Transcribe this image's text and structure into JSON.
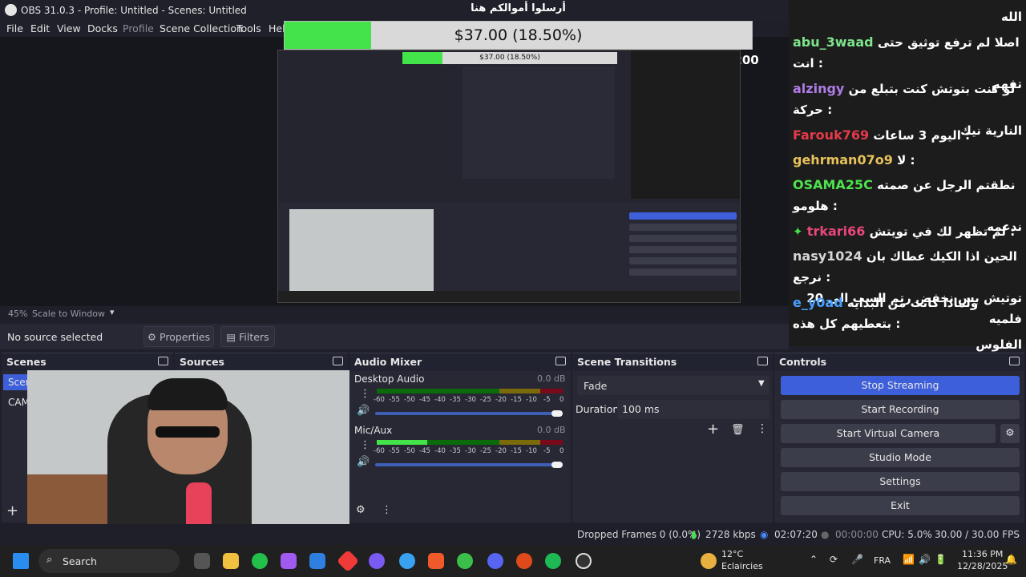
{
  "window": {
    "title": "OBS 31.0.3 - Profile: Untitled - Scenes: Untitled",
    "minimize": "–",
    "maximize": "☐",
    "close": "✕"
  },
  "menu": [
    "File",
    "Edit",
    "View",
    "Docks",
    "Profile",
    "Scene Collection",
    "Tools",
    "Help"
  ],
  "donation": {
    "title": "أرسلوا أموالكم هنا",
    "amount": "$37.00 (18.50%)",
    "progress_fraction": 0.185,
    "min": "$0",
    "max": "$200",
    "fill_color": "#43e34a"
  },
  "chat": {
    "top_line": "الله",
    "messages": [
      {
        "user": "abu_3waad",
        "color": "#7ee38a",
        "text": "اصلا لم ترفع توثيق حتى انت :",
        "text2": "تفهم",
        "badge": ""
      },
      {
        "user": "alzingy",
        "color": "#b07ce8",
        "text": "لو كنت بتوتش كنت بتبلع من حركة :",
        "text2": "النارية نيك",
        "badge": ""
      },
      {
        "user": "Farouk769",
        "color": "#e63a4a",
        "text": "اليوم 3 ساعات :",
        "text2": "",
        "badge": ""
      },
      {
        "user": "gehrman07o9",
        "color": "#e8c35a",
        "text": "لا :",
        "text2": "",
        "badge": ""
      },
      {
        "user": "OSAMA25C",
        "color": "#4ee24e",
        "text": "نطقتم الرجل عن صمته هلومو :",
        "text2": "ندعمه",
        "badge": ""
      },
      {
        "user": "trkari66",
        "color": "#e8477a",
        "text": "لم تظهر لك في تويتش :",
        "text2": "",
        "badge": "✦"
      },
      {
        "user": "nasy1024",
        "color": "#d6d6d6",
        "text": "الحين اذا الكيك عطاك بان نرجع :",
        "text2": "توتيش بس نخفض رتم السب الى 20 فلميه",
        "badge": ""
      },
      {
        "user": "e_y0ad",
        "color": "#4aa0ff",
        "text": "ولماذا كانت من البدايه بتعطيهم كل هذه :",
        "text2": "الفلوس",
        "badge": ""
      }
    ]
  },
  "preview": {
    "zoom": "45%",
    "scale_mode": "Scale to Window"
  },
  "source_toolbar": {
    "no_source": "No source selected",
    "properties": "Properties",
    "filters": "Filters"
  },
  "docks": {
    "scenes": {
      "title": "Scenes",
      "items": [
        "Scene",
        "CAM"
      ]
    },
    "sources": {
      "title": "Sources"
    },
    "mixer": {
      "title": "Audio Mixer",
      "channels": [
        {
          "name": "Desktop Audio",
          "db": "0.0 dB",
          "level": 0.0,
          "volume": 1.0
        },
        {
          "name": "Mic/Aux",
          "db": "0.0 dB",
          "level": 0.27,
          "volume": 1.0
        }
      ],
      "ticks": [
        "-60",
        "-55",
        "-50",
        "-45",
        "-40",
        "-35",
        "-30",
        "-25",
        "-20",
        "-15",
        "-10",
        "-5",
        "0"
      ]
    },
    "transitions": {
      "title": "Scene Transitions",
      "selected": "Fade",
      "duration_label": "Duration",
      "duration_value": "100 ms"
    },
    "controls": {
      "title": "Controls",
      "buttons": [
        "Stop Streaming",
        "Start Recording",
        "Start Virtual Camera",
        "Studio Mode",
        "Settings",
        "Exit"
      ],
      "streaming_color": "#3d5fd9"
    }
  },
  "status": {
    "dropped": "Dropped Frames 0 (0.0%)",
    "bitrate": "2728 kbps",
    "stream_time": "02:07:20",
    "record_time": "00:00:00",
    "cpu": "CPU: 5.0%",
    "fps": "30.00 / 30.00 FPS"
  },
  "taskbar": {
    "search": "Search",
    "weather_temp": "12°C",
    "weather_loc": "Eclaircies",
    "lang": "FRA",
    "time": "11:36 PM",
    "date": "12/28/2025"
  }
}
